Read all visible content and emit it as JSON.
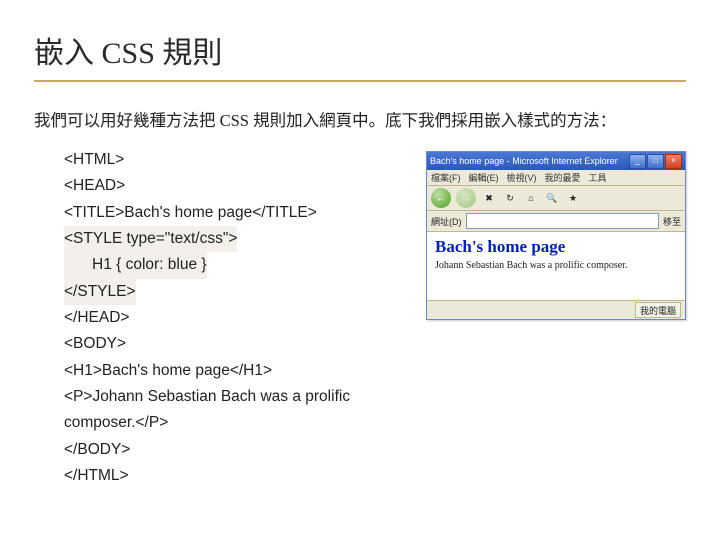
{
  "title": "嵌入 CSS 規則",
  "desc": "我們可以用好幾種方法把 CSS 規則加入網頁中。底下我們採用嵌入樣式的方法：",
  "code": {
    "l1": "<HTML>",
    "l2": "<HEAD>",
    "l3": "<TITLE>Bach's home page</TITLE>",
    "l4": "<STYLE type=\"text/css\">",
    "l5": "H1 { color: blue }",
    "l6": "</STYLE>",
    "l7": "</HEAD>",
    "l8": "<BODY>",
    "l9": "<H1>Bach's home page</H1>",
    "l10": "<P>Johann Sebastian Bach was a prolific composer.</P>",
    "l11": "</BODY>",
    "l12": "</HTML>"
  },
  "browser": {
    "title": "Bach's home page - Microsoft Internet Explorer",
    "menu": {
      "file": "檔案(F)",
      "edit": "編輯(E)",
      "view": "檢視(V)",
      "fav": "我的最愛",
      "tools": "工具"
    },
    "addr_label": "網址(D)",
    "go": "移至",
    "h1": "Bach's home page",
    "p": "Johann Sebastian Bach was a prolific composer.",
    "status": "我的電腦"
  }
}
